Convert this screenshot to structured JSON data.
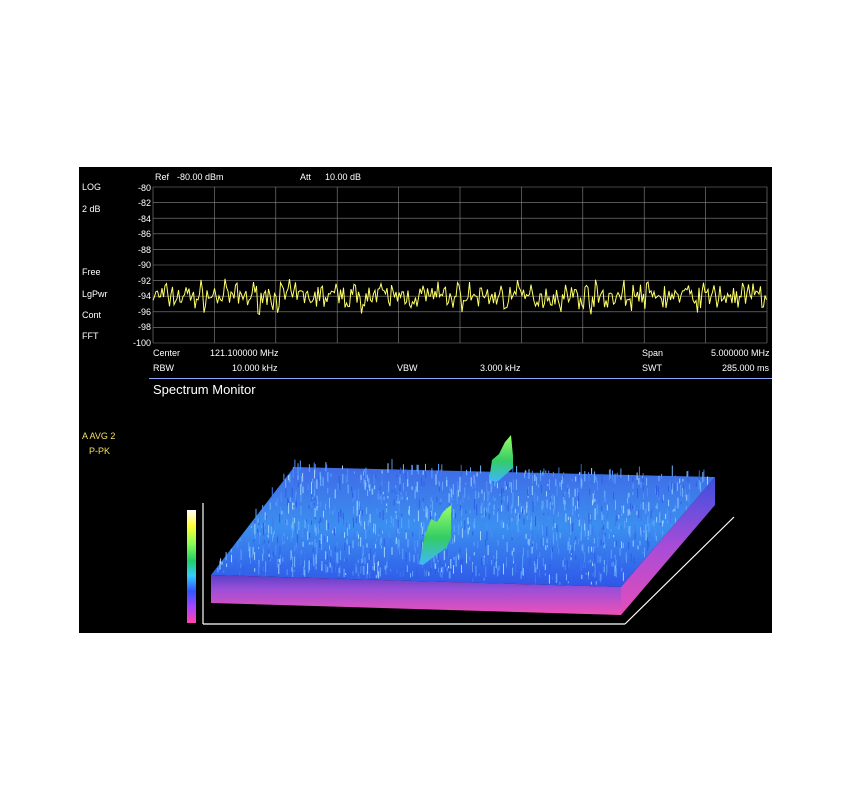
{
  "display": {
    "ref_label": "Ref",
    "ref_value": "-80.00 dBm",
    "att_label": "Att",
    "att_value": "10.00 dB",
    "left_panel": [
      "LOG",
      "2 dB",
      "Free",
      "LgPwr",
      "Cont",
      "FFT"
    ],
    "yticks": [
      "-80",
      "-82",
      "-84",
      "-86",
      "-88",
      "-90",
      "-92",
      "-94",
      "-96",
      "-98",
      "-100"
    ],
    "center_label": "Center",
    "center_value": "121.100000 MHz",
    "span_label": "Span",
    "span_value": "5.000000 MHz",
    "rbw_label": "RBW",
    "rbw_value": "10.000 kHz",
    "vbw_label": "VBW",
    "vbw_value": "3.000 kHz",
    "swt_label": "SWT",
    "swt_value": "285.000 ms",
    "monitor_title": "Spectrum Monitor",
    "avg_mode": "A AVG  2",
    "detector_mode": "P-PK",
    "trace_color": "#ffff66",
    "grid_color": "#888888",
    "title_line_color": "#8fa8ff"
  },
  "chart_data": {
    "type": "line",
    "ylim": [
      -100,
      -80
    ],
    "noise_floor_dbm": -94,
    "noise_spread_db": 1.5
  }
}
